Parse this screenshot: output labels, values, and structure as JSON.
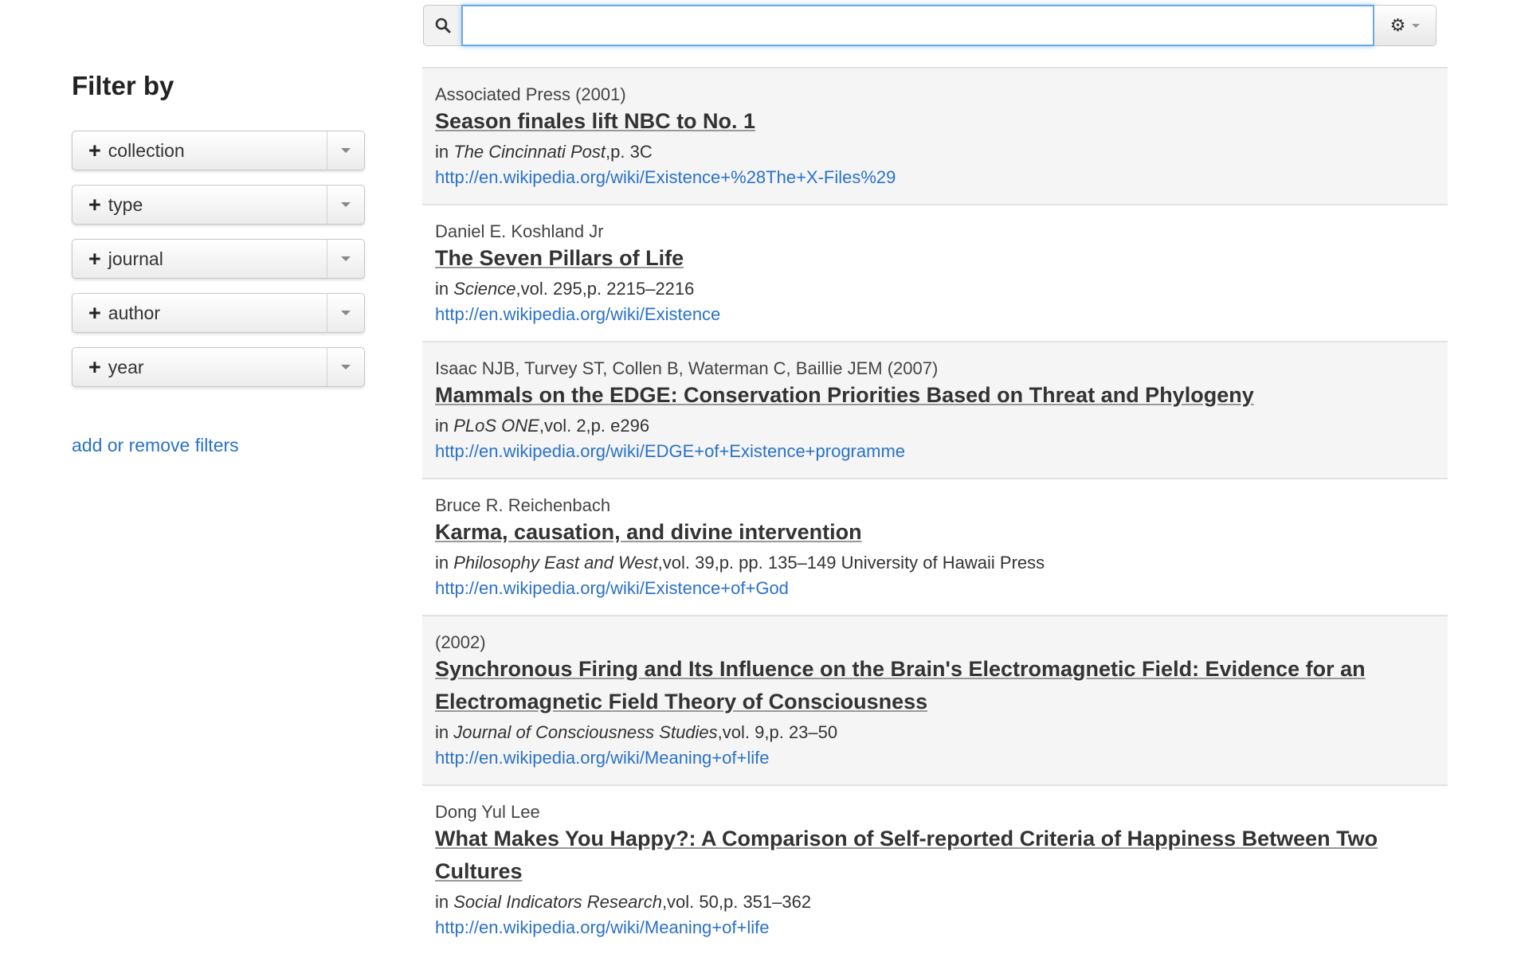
{
  "search": {
    "value": "",
    "placeholder": ""
  },
  "sidebar": {
    "heading": "Filter by",
    "filters": [
      {
        "label": "collection"
      },
      {
        "label": "type"
      },
      {
        "label": "journal"
      },
      {
        "label": "author"
      },
      {
        "label": "year"
      }
    ],
    "add_remove_label": "add or remove filters"
  },
  "results": [
    {
      "meta": "Associated Press (2001)",
      "title": "Season finales lift NBC to No. 1",
      "source_prefix": "in ",
      "journal": "The Cincinnati Post",
      "source_details": ",p. 3C",
      "url": "http://en.wikipedia.org/wiki/Existence+%28The+X-Files%29"
    },
    {
      "meta": "Daniel E. Koshland Jr",
      "title": "The Seven Pillars of Life",
      "source_prefix": "in ",
      "journal": "Science",
      "source_details": ",vol. 295,p. 2215–2216",
      "url": "http://en.wikipedia.org/wiki/Existence"
    },
    {
      "meta": "Isaac NJB, Turvey ST, Collen B, Waterman C, Baillie JEM (2007)",
      "title": "Mammals on the EDGE: Conservation Priorities Based on Threat and Phylogeny",
      "source_prefix": "in ",
      "journal": "PLoS ONE",
      "source_details": ",vol. 2,p. e296",
      "url": "http://en.wikipedia.org/wiki/EDGE+of+Existence+programme"
    },
    {
      "meta": "Bruce R. Reichenbach",
      "title": "Karma, causation, and divine intervention",
      "source_prefix": "in ",
      "journal": "Philosophy East and West",
      "source_details": ",vol. 39,p. pp. 135–149 University of Hawaii Press",
      "url": "http://en.wikipedia.org/wiki/Existence+of+God"
    },
    {
      "meta": "(2002)",
      "title": "Synchronous Firing and Its Influence on the Brain's Electromagnetic Field: Evidence for an Electromagnetic Field Theory of Consciousness",
      "source_prefix": "in ",
      "journal": "Journal of Consciousness Studies",
      "source_details": ",vol. 9,p. 23–50",
      "url": "http://en.wikipedia.org/wiki/Meaning+of+life"
    },
    {
      "meta": "Dong Yul Lee",
      "title": "What Makes You Happy?: A Comparison of Self-reported Criteria of Happiness Between Two Cultures",
      "source_prefix": "in ",
      "journal": "Social Indicators Research",
      "source_details": ",vol. 50,p. 351–362",
      "url": "http://en.wikipedia.org/wiki/Meaning+of+life"
    }
  ],
  "icons": {
    "search": "search-icon",
    "settings": "gear-icon",
    "filter_add": "plus-icon",
    "filter_dropdown": "caret-down-icon"
  },
  "colors": {
    "link": "#2a72c8",
    "focus_border": "#6aa8e8",
    "alt_row": "#f5f5f5"
  }
}
